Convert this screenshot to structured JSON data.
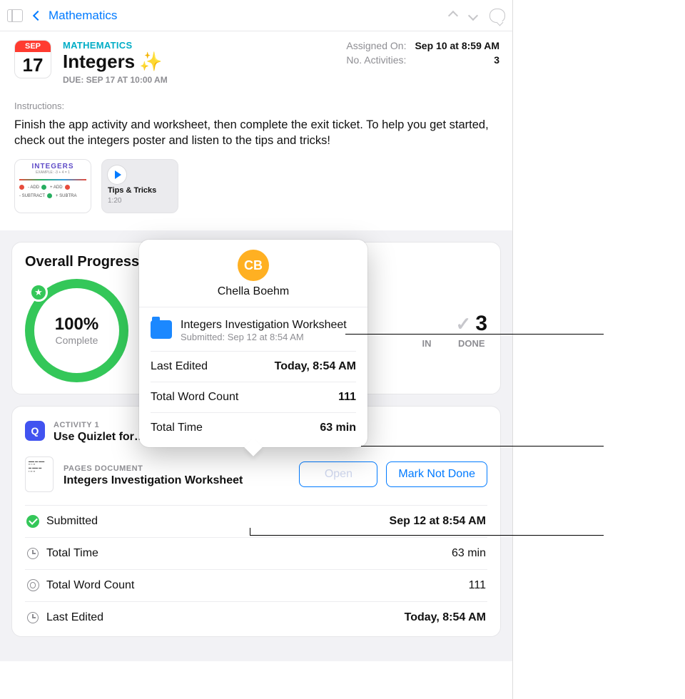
{
  "nav": {
    "back": "Mathematics"
  },
  "header": {
    "month": "SEP",
    "day": "17",
    "subject": "MATHEMATICS",
    "title": "Integers",
    "due": "DUE: SEP 17 AT 10:00 AM"
  },
  "meta": {
    "assigned_label": "Assigned On:",
    "assigned_value": "Sep 10 at 8:59 AM",
    "activities_label": "No. Activities:",
    "activities_value": "3"
  },
  "instructions": {
    "label": "Instructions:",
    "text": "Finish the app activity and worksheet, then complete the exit ticket. To help you get started, check out the integers poster and listen to the tips and tricks!"
  },
  "attachments": {
    "poster_title": "INTEGERS",
    "media_title": "Tips & Tricks",
    "media_duration": "1:20"
  },
  "progress": {
    "title": "Overall Progress",
    "percent": "100%",
    "complete_label": "Complete",
    "done_count": "3",
    "done_label": "DONE",
    "hidden_label_frag": "IN"
  },
  "activity1": {
    "eyebrow": "ACTIVITY 1",
    "title": "Use Quizlet for…"
  },
  "doc": {
    "eyebrow": "PAGES DOCUMENT",
    "title": "Integers Investigation Worksheet",
    "open": "Open",
    "mark": "Mark Not Done"
  },
  "details": {
    "submitted_label": "Submitted",
    "submitted_value": "Sep 12 at 8:54 AM",
    "time_label": "Total Time",
    "time_value": "63 min",
    "wc_label": "Total Word Count",
    "wc_value": "111",
    "edit_label": "Last Edited",
    "edit_value": "Today, 8:54 AM"
  },
  "popover": {
    "initials": "CB",
    "name": "Chella Boehm",
    "file_title": "Integers Investigation Worksheet",
    "file_sub": "Submitted: Sep 12 at 8:54 AM",
    "k1": "Last Edited",
    "v1": "Today, 8:54 AM",
    "k2": "Total Word Count",
    "v2": "111",
    "k3": "Total Time",
    "v3": "63 min"
  }
}
